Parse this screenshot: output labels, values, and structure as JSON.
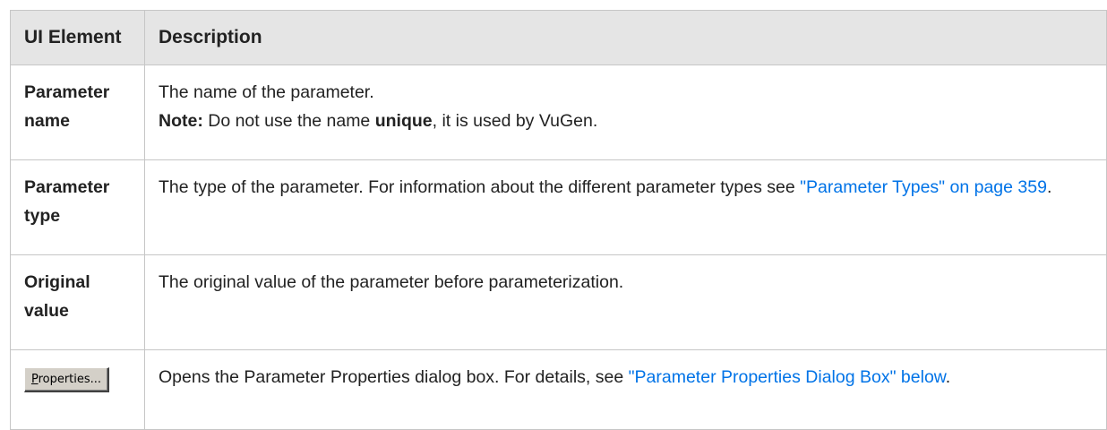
{
  "table": {
    "header": {
      "col1": "UI Element",
      "col2": "Description"
    },
    "rows": [
      {
        "element": "Parameter name",
        "line1": "The name of the parameter.",
        "note_label": "Note:",
        "note_pre": " Do not use the name ",
        "note_bold": "unique",
        "note_post": ", it is used by VuGen."
      },
      {
        "element": "Parameter type",
        "text": "The type of the parameter. For information about the different parameter types see ",
        "link": "\"Parameter Types\" on page 359",
        "post": "."
      },
      {
        "element": "Original value",
        "text": "The original value of the parameter before parameterization."
      },
      {
        "button_accel": "P",
        "button_rest": "roperties...",
        "text": "Opens the Parameter Properties dialog box. For details, see ",
        "link": "\"Parameter Properties Dialog Box\" below",
        "post": "."
      }
    ]
  },
  "colors": {
    "link": "#0073e7",
    "header_bg": "#e5e5e5",
    "border": "#c6c6c6",
    "button_face": "#d4d0c8"
  }
}
